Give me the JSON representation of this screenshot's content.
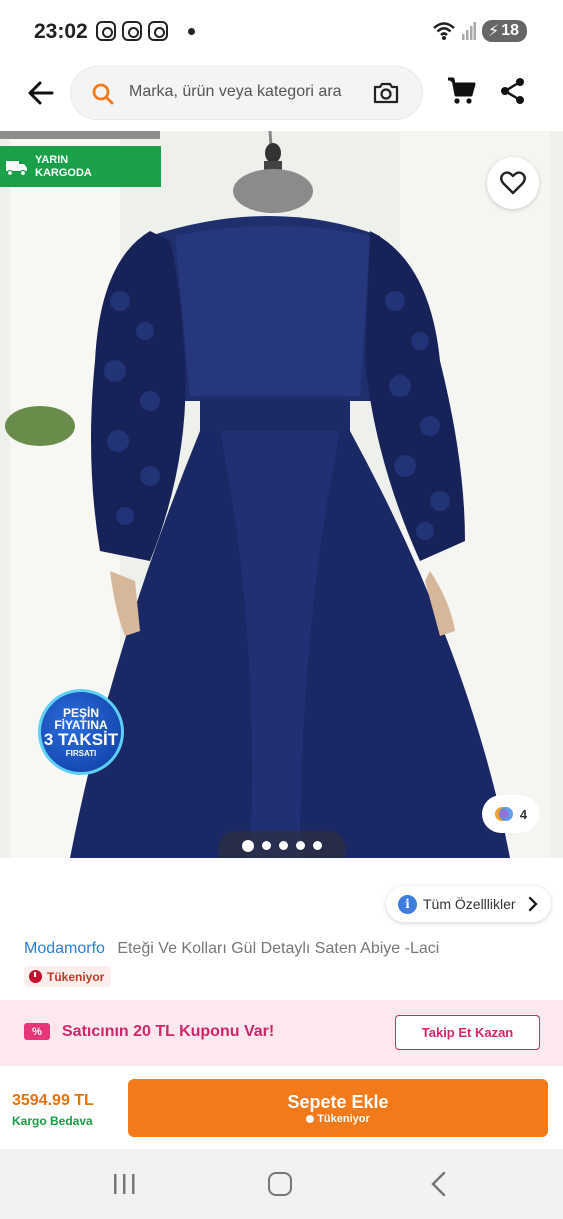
{
  "status_bar": {
    "time": "23:02",
    "battery": "18"
  },
  "header": {
    "search_placeholder": "Marka, ürün veya kategori ara"
  },
  "gallery": {
    "delivery_badge": "YARIN KARGODA",
    "delivery_line1": "YARIN",
    "delivery_line2": "KARGODA",
    "taksit_line1": "PEŞİN FİYATINA",
    "taksit_line2": "3 TAKSİT",
    "taksit_line3": "FIRSATI",
    "image_count": "4",
    "dots_total": 5,
    "dots_active": 1
  },
  "product": {
    "features_button": "Tüm Özelllikler",
    "brand": "Modamorfo",
    "name": "Eteği Ve Kolları Gül Detaylı Saten Abiye -Laci",
    "stock_badge": "Tükeniyor"
  },
  "coupon": {
    "icon_text": "%",
    "text": "Satıcının 20 TL Kuponu Var!",
    "button": "Takip Et Kazan"
  },
  "price_bar": {
    "price": "3594.99 TL",
    "shipping": "Kargo Bedava",
    "add_to_cart": "Sepete Ekle",
    "add_to_cart_sub": "Tükeniyor"
  },
  "colors": {
    "accent_orange": "#f27a1a",
    "brand_blue": "#2a7fd4",
    "green": "#1ba04a",
    "pink": "#d4246a"
  },
  "icons": [
    "back-icon",
    "search-icon",
    "camera-icon",
    "cart-icon",
    "share-icon",
    "heart-icon",
    "info-icon",
    "chevron-right-icon",
    "truck-icon",
    "coupon-icon"
  ]
}
